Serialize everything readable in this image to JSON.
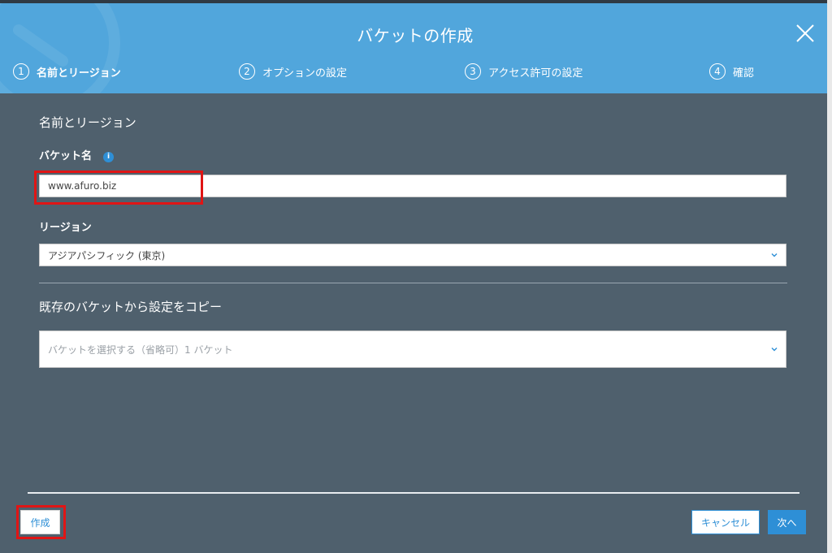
{
  "dialog": {
    "title": "バケットの作成",
    "close_icon": "close-icon"
  },
  "steps": [
    {
      "number": "1",
      "label": "名前とリージョン",
      "active": true
    },
    {
      "number": "2",
      "label": "オプションの設定",
      "active": false
    },
    {
      "number": "3",
      "label": "アクセス許可の設定",
      "active": false
    },
    {
      "number": "4",
      "label": "確認",
      "active": false
    }
  ],
  "form": {
    "section_title": "名前とリージョン",
    "bucket_name_label": "バケット名",
    "info_icon": "info-icon",
    "bucket_name_value": "www.afuro.biz",
    "region_label": "リージョン",
    "region_value": "アジアパシフィック (東京)",
    "copy_section_title": "既存のバケットから設定をコピー",
    "copy_placeholder": "バケットを選択する（省略可）1 バケット"
  },
  "footer": {
    "create_label": "作成",
    "cancel_label": "キャンセル",
    "next_label": "次へ"
  },
  "colors": {
    "header": "#51a6dc",
    "body": "#4f606d",
    "accent": "#2e8fd6",
    "highlight": "#e01515"
  }
}
